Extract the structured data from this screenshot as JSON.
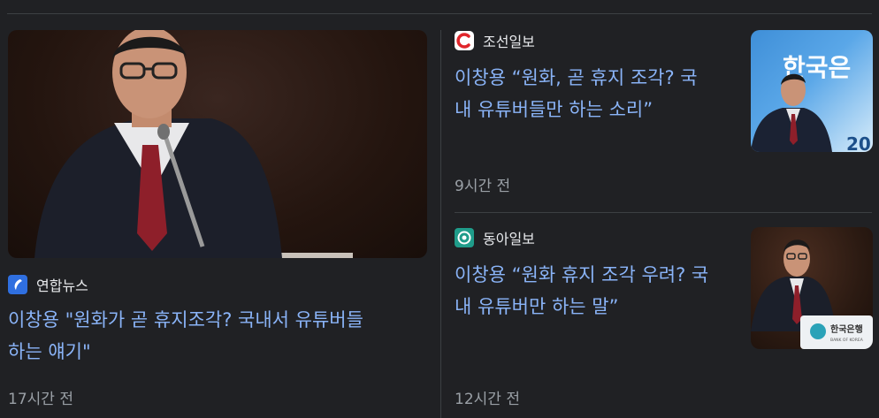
{
  "articles": [
    {
      "source": "연합뉴스",
      "headline_lines": [
        "이창용 \"원화가 곧 휴지조각? 국내서 유튜버들",
        "하는 얘기\""
      ],
      "time": "17시간 전",
      "logo_color": "#2f6fe0"
    },
    {
      "source": "조선일보",
      "headline_lines": [
        "이창용 “원화, 곧 휴지 조각? 국",
        "내 유튜버들만 하는 소리”"
      ],
      "time": "9시간 전",
      "logo_color": "#e0262b"
    },
    {
      "source": "동아일보",
      "headline_lines": [
        "이창용 “원화 휴지 조각 우려? 국",
        "내 유튜버만 하는 말”"
      ],
      "time": "12시간 전",
      "logo_color": "#1f9c8a"
    }
  ],
  "thumbnails": {
    "thumb1_sign": "한국은",
    "thumb1_year": "20",
    "thumb2_sign": "한국은행",
    "thumb2_sign_sub": "BANK OF KOREA"
  },
  "colors": {
    "headline": "#8ab4f8",
    "background": "#202124",
    "meta": "#9aa0a6"
  }
}
